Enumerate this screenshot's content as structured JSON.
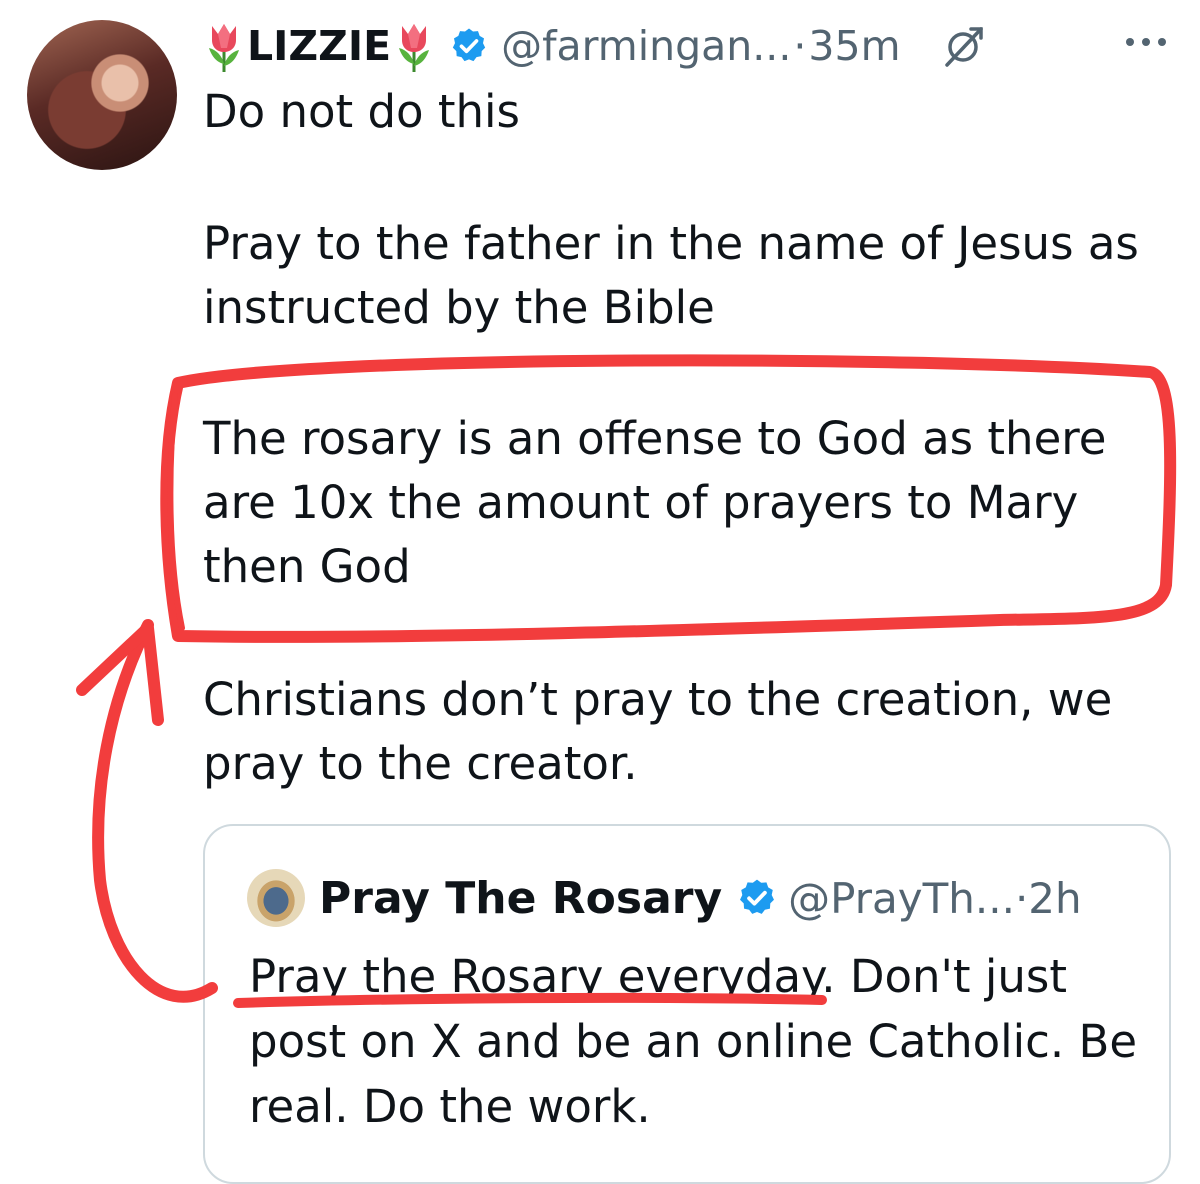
{
  "tweet": {
    "author": {
      "name_emoji": "🌷",
      "display_name": "LIZZIE",
      "handle": "@farmingan...",
      "separator": "·",
      "time": "35m"
    },
    "icons": {
      "avatar": "profile-photo",
      "verified": "verified-badge-icon",
      "grok": "grok-icon",
      "more": "more-options-icon"
    },
    "body": {
      "line1": "Do not do this",
      "line2": "Pray to the  father in the name of Jesus as instructed by the Bible",
      "line3": "The rosary is an offense to God as there are 10x the amount of prayers to Mary then God",
      "line4": "Christians don’t pray to the creation, we pray to the creator."
    }
  },
  "quoted_tweet": {
    "author": {
      "display_name": "Pray The Rosary",
      "handle": "@PrayTh...",
      "separator": "·",
      "time": "2h"
    },
    "text_highlighted": "Pray the Rosary everyday",
    "text_rest": ". Don't just post on X and be an online Catholic. Be real. Do the work."
  },
  "annotation": {
    "color": "#f23d3d",
    "shapes": [
      "box-around-rosary-claim",
      "arrow-from-underline-to-box",
      "underline-pray-the-rosary-everyday"
    ]
  },
  "colors": {
    "text": "#0f1419",
    "secondary": "#536471",
    "verified_blue": "#1d9bf0",
    "border": "#cfd9de"
  }
}
